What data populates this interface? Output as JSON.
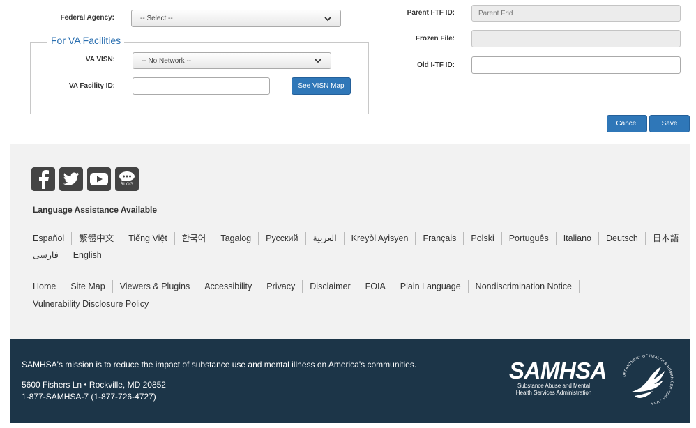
{
  "form": {
    "federal_agency_label": "Federal Agency:",
    "federal_agency_value": "-- Select --",
    "va_legend": "For VA Facilities",
    "va_visn_label": "VA VISN:",
    "va_visn_value": "-- No Network --",
    "va_facility_label": "VA Facility ID:",
    "va_facility_value": "",
    "see_visn_button": "See VISN Map",
    "parent_label": "Parent I-TF ID:",
    "parent_placeholder": "Parent Frid",
    "frozen_label": "Frozen File:",
    "frozen_value": "",
    "old_label": "Old I-TF ID:",
    "old_value": "",
    "cancel_button": "Cancel",
    "save_button": "Save"
  },
  "footer": {
    "social_icons": [
      "facebook-icon",
      "twitter-icon",
      "youtube-icon",
      "blog-icon"
    ],
    "blog_text": "BLOG",
    "language_title": "Language Assistance Available",
    "languages_row1": [
      "Español",
      "繁體中文",
      "Tiếng Việt",
      "한국어",
      "Tagalog",
      "Русский",
      "العربية",
      "Kreyòl Ayisyen",
      "Français",
      "Polski",
      "Português",
      "Italiano",
      "Deutsch",
      "日本語"
    ],
    "languages_row2": [
      "فارسی",
      "English"
    ],
    "links_row1": [
      "Home",
      "Site Map",
      "Viewers & Plugins",
      "Accessibility",
      "Privacy",
      "Disclaimer",
      "FOIA",
      "Plain Language",
      "Nondiscrimination Notice"
    ],
    "links_row2": [
      "Vulnerability Disclosure Policy"
    ]
  },
  "bottom": {
    "mission": "SAMHSA's mission is to reduce the impact of substance use and mental illness on America's communities.",
    "address": "5600 Fishers Ln • Rockville, MD 20852",
    "phone": "1-877-SAMHSA-7 (1-877-726-4727)",
    "logo_word": "SAMHSA",
    "logo_sub": "Substance Abuse and Mental Health Services Administration",
    "seal_text": "DEPARTMENT OF HEALTH & HUMAN SERVICES · USA"
  },
  "colors": {
    "primary_button": "#2f77b8",
    "footer_bg": "#f2f2f2",
    "bottom_bg": "#1c3548",
    "legend": "#2a6fb0"
  }
}
